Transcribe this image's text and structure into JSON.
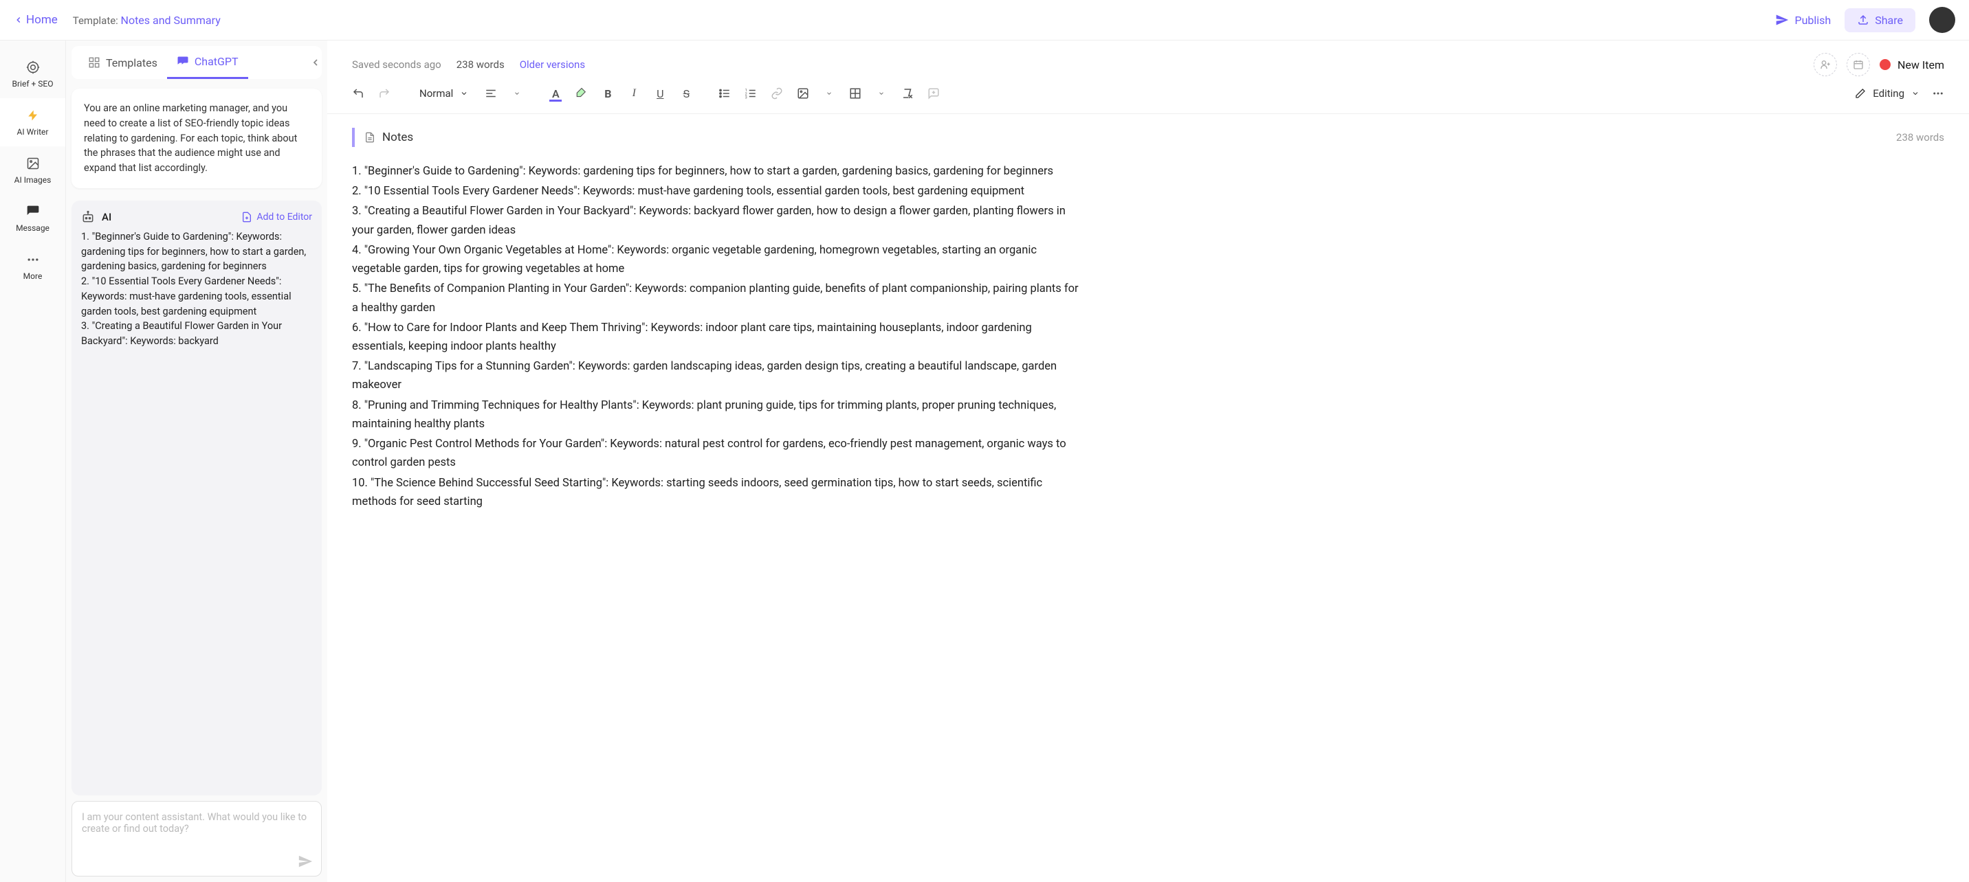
{
  "topbar": {
    "home": "Home",
    "template_prefix": "Template: ",
    "template_name": "Notes and Summary",
    "publish": "Publish",
    "share": "Share"
  },
  "rail": {
    "brief": "Brief + SEO",
    "writer": "AI Writer",
    "images": "AI Images",
    "message": "Message",
    "more": "More"
  },
  "tabs": {
    "templates": "Templates",
    "chatgpt": "ChatGPT"
  },
  "system_prompt": "You are an online marketing manager, and you need to create a list of SEO-friendly topic ideas relating to gardening. For each topic, think about the phrases that the audience might use and expand that list accordingly.",
  "ai": {
    "label": "AI",
    "add": "Add to Editor",
    "body": "1. \"Beginner's Guide to Gardening\": Keywords: gardening tips for beginners, how to start a garden, gardening basics, gardening for beginners\n2. \"10 Essential Tools Every Gardener Needs\": Keywords: must-have gardening tools, essential garden tools, best gardening equipment\n3. \"Creating a Beautiful Flower Garden in Your Backyard\": Keywords: backyard"
  },
  "chat_input_placeholder": "I am your content assistant. What would you like to create or find out today?",
  "docmeta": {
    "saved": "Saved seconds ago",
    "words": "238 words",
    "older": "Older versions",
    "new_item": "New Item"
  },
  "toolbar": {
    "style": "Normal",
    "editing": "Editing"
  },
  "notes": {
    "title": "Notes",
    "wc": "238 words"
  },
  "doc_lines": [
    "1. \"Beginner's Guide to Gardening\": Keywords: gardening tips for beginners, how to start a garden, gardening basics, gardening for beginners",
    "2. \"10 Essential Tools Every Gardener Needs\": Keywords: must-have gardening tools, essential garden tools, best gardening equipment",
    "3. \"Creating a Beautiful Flower Garden in Your Backyard\": Keywords: backyard flower garden, how to design a flower garden, planting flowers in your garden, flower garden ideas",
    "4. \"Growing Your Own Organic Vegetables at Home\": Keywords: organic vegetable gardening, homegrown vegetables, starting an organic vegetable garden, tips for growing vegetables at home",
    "5. \"The Benefits of Companion Planting in Your Garden\": Keywords: companion planting guide, benefits of plant companionship, pairing plants for a healthy garden",
    "6. \"How to Care for Indoor Plants and Keep Them Thriving\": Keywords: indoor plant care tips, maintaining houseplants, indoor gardening essentials, keeping indoor plants healthy",
    "7. \"Landscaping Tips for a Stunning Garden\": Keywords: garden landscaping ideas, garden design tips, creating a beautiful landscape, garden makeover",
    "8. \"Pruning and Trimming Techniques for Healthy Plants\": Keywords: plant pruning guide, tips for trimming plants, proper pruning techniques, maintaining healthy plants",
    "9. \"Organic Pest Control Methods for Your Garden\": Keywords: natural pest control for gardens, eco-friendly pest management, organic ways to control garden pests",
    "10. \"The Science Behind Successful Seed Starting\": Keywords: starting seeds indoors, seed germination tips, how to start seeds, scientific methods for seed starting"
  ]
}
